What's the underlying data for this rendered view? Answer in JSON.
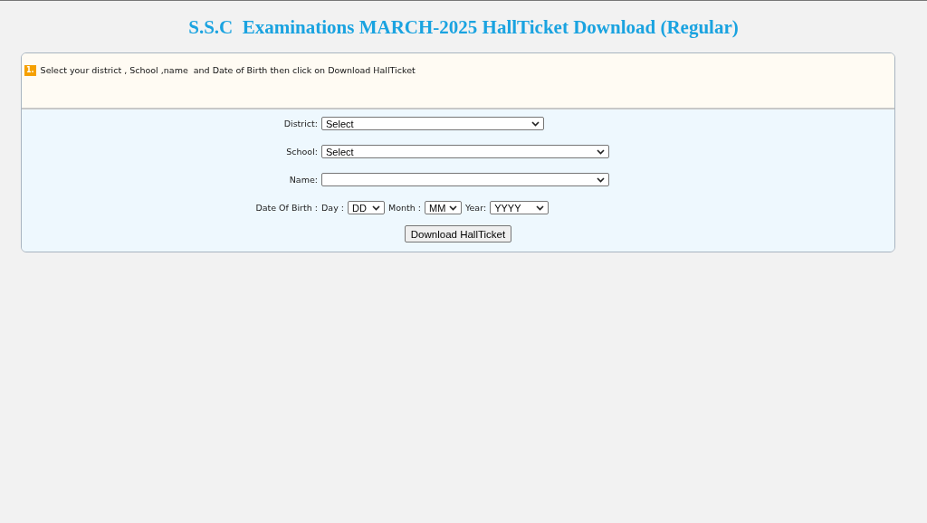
{
  "title": "S.S.C  Examinations MARCH-2025 HallTicket Download (Regular)",
  "instruction": {
    "number": "1.",
    "text": "Select your district , School ,name  and Date of Birth then click on Download HallTicket"
  },
  "fields": [
    {
      "label": "District:",
      "value": "Select"
    },
    {
      "label": "School:",
      "value": "Select"
    },
    {
      "label": "Name:"
    }
  ],
  "date_of_birth": {
    "label": "Date Of Birth :",
    "parts": [
      {
        "label": "Day :",
        "value": "DD"
      },
      {
        "label": "Month :",
        "value": "MM"
      },
      {
        "label": "Year:",
        "value": "YYYY"
      }
    ]
  },
  "button": "Download HallTicket"
}
